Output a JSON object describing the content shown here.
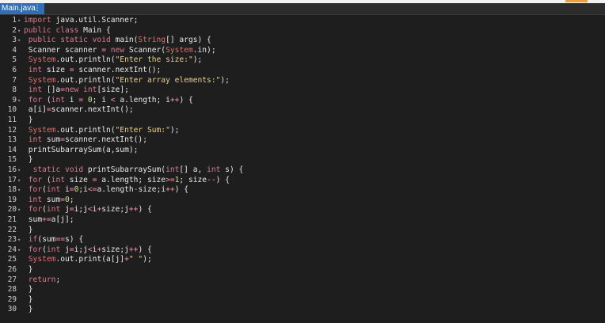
{
  "tab": {
    "label": "Main.java",
    "menu_glyph": "⋮"
  },
  "colors": {
    "tab_active": "#2f6fb8",
    "background": "#1e1e1e",
    "keyword": "#d77a8e",
    "string": "#e8d08a",
    "system": "#e26d6d"
  },
  "editor": {
    "lines": [
      {
        "n": "1",
        "fold": "▾",
        "segs": [
          [
            "kw",
            "import"
          ],
          [
            "pl",
            " java.util.Scanner;"
          ]
        ]
      },
      {
        "n": "2",
        "fold": "▾",
        "segs": [
          [
            "kw",
            "public"
          ],
          [
            "pl",
            " "
          ],
          [
            "kw",
            "class"
          ],
          [
            "pl",
            " Main {"
          ]
        ]
      },
      {
        "n": "3",
        "fold": "▾",
        "segs": [
          [
            "pl",
            " "
          ],
          [
            "kw",
            "public"
          ],
          [
            "pl",
            " "
          ],
          [
            "kw",
            "static"
          ],
          [
            "pl",
            " "
          ],
          [
            "kw",
            "void"
          ],
          [
            "pl",
            " main("
          ],
          [
            "sys",
            "String"
          ],
          [
            "pl",
            "[] args) {"
          ]
        ]
      },
      {
        "n": "4",
        "fold": "",
        "segs": [
          [
            "pl",
            " Scanner scanner "
          ],
          [
            "op",
            "="
          ],
          [
            "pl",
            " "
          ],
          [
            "kw",
            "new"
          ],
          [
            "pl",
            " Scanner("
          ],
          [
            "sys",
            "System"
          ],
          [
            "pl",
            ".in);"
          ]
        ]
      },
      {
        "n": "5",
        "fold": "",
        "segs": [
          [
            "pl",
            " "
          ],
          [
            "sys",
            "System"
          ],
          [
            "pl",
            ".out.println("
          ],
          [
            "str",
            "\"Enter the size:\""
          ],
          [
            "pl",
            ");"
          ]
        ]
      },
      {
        "n": "6",
        "fold": "",
        "segs": [
          [
            "pl",
            " "
          ],
          [
            "kw",
            "int"
          ],
          [
            "pl",
            " size "
          ],
          [
            "op",
            "="
          ],
          [
            "pl",
            " scanner.nextInt();"
          ]
        ]
      },
      {
        "n": "7",
        "fold": "",
        "segs": [
          [
            "pl",
            " "
          ],
          [
            "sys",
            "System"
          ],
          [
            "pl",
            ".out.println("
          ],
          [
            "str",
            "\"Enter array elements:\""
          ],
          [
            "pl",
            ");"
          ]
        ]
      },
      {
        "n": "8",
        "fold": "",
        "segs": [
          [
            "pl",
            " "
          ],
          [
            "kw",
            "int"
          ],
          [
            "pl",
            " []a"
          ],
          [
            "op",
            "="
          ],
          [
            "kw",
            "new"
          ],
          [
            "pl",
            " "
          ],
          [
            "kw",
            "int"
          ],
          [
            "pl",
            "[size];"
          ]
        ]
      },
      {
        "n": "9",
        "fold": "▾",
        "segs": [
          [
            "pl",
            " "
          ],
          [
            "kw",
            "for"
          ],
          [
            "pl",
            " ("
          ],
          [
            "kw",
            "int"
          ],
          [
            "pl",
            " i "
          ],
          [
            "op",
            "="
          ],
          [
            "pl",
            " "
          ],
          [
            "num",
            "0"
          ],
          [
            "pl",
            "; i "
          ],
          [
            "op",
            "<"
          ],
          [
            "pl",
            " a.length; i"
          ],
          [
            "op",
            "++"
          ],
          [
            "pl",
            ") {"
          ]
        ]
      },
      {
        "n": "10",
        "fold": "",
        "segs": [
          [
            "pl",
            " a[i]"
          ],
          [
            "op",
            "="
          ],
          [
            "pl",
            "scanner.nextInt();"
          ]
        ]
      },
      {
        "n": "11",
        "fold": "",
        "segs": [
          [
            "pl",
            " }"
          ]
        ]
      },
      {
        "n": "12",
        "fold": "",
        "segs": [
          [
            "pl",
            " "
          ],
          [
            "sys",
            "System"
          ],
          [
            "pl",
            ".out.println("
          ],
          [
            "str",
            "\"Enter Sum:\""
          ],
          [
            "pl",
            ");"
          ]
        ]
      },
      {
        "n": "13",
        "fold": "",
        "segs": [
          [
            "pl",
            " "
          ],
          [
            "kw",
            "int"
          ],
          [
            "pl",
            " sum"
          ],
          [
            "op",
            "="
          ],
          [
            "pl",
            "scanner.nextInt();"
          ]
        ]
      },
      {
        "n": "14",
        "fold": "",
        "segs": [
          [
            "pl",
            " printSubarraySum(a,sum);"
          ]
        ]
      },
      {
        "n": "15",
        "fold": "",
        "segs": [
          [
            "pl",
            " }"
          ]
        ]
      },
      {
        "n": "16",
        "fold": "▾",
        "segs": [
          [
            "pl",
            "  "
          ],
          [
            "kw",
            "static"
          ],
          [
            "pl",
            " "
          ],
          [
            "kw",
            "void"
          ],
          [
            "pl",
            " printSubarraySum("
          ],
          [
            "kw",
            "int"
          ],
          [
            "pl",
            "[] a, "
          ],
          [
            "kw",
            "int"
          ],
          [
            "pl",
            " s) {"
          ]
        ]
      },
      {
        "n": "17",
        "fold": "▾",
        "segs": [
          [
            "pl",
            " "
          ],
          [
            "kw",
            "for"
          ],
          [
            "pl",
            " ("
          ],
          [
            "kw",
            "int"
          ],
          [
            "pl",
            " size "
          ],
          [
            "op",
            "="
          ],
          [
            "pl",
            " a.length; size"
          ],
          [
            "op",
            ">="
          ],
          [
            "num",
            "1"
          ],
          [
            "pl",
            "; size"
          ],
          [
            "op",
            "--"
          ],
          [
            "pl",
            ") {"
          ]
        ]
      },
      {
        "n": "18",
        "fold": "▾",
        "segs": [
          [
            "pl",
            " "
          ],
          [
            "kw",
            "for"
          ],
          [
            "pl",
            "("
          ],
          [
            "kw",
            "int"
          ],
          [
            "pl",
            " i"
          ],
          [
            "op",
            "="
          ],
          [
            "num",
            "0"
          ],
          [
            "pl",
            ";i"
          ],
          [
            "op",
            "<="
          ],
          [
            "pl",
            "a.length"
          ],
          [
            "op",
            "-"
          ],
          [
            "pl",
            "size;i"
          ],
          [
            "op",
            "++"
          ],
          [
            "pl",
            ") {"
          ]
        ]
      },
      {
        "n": "19",
        "fold": "",
        "segs": [
          [
            "pl",
            " "
          ],
          [
            "kw",
            "int"
          ],
          [
            "pl",
            " sum"
          ],
          [
            "op",
            "="
          ],
          [
            "num",
            "0"
          ],
          [
            "pl",
            ";"
          ]
        ]
      },
      {
        "n": "20",
        "fold": "▾",
        "segs": [
          [
            "pl",
            " "
          ],
          [
            "kw",
            "for"
          ],
          [
            "pl",
            "("
          ],
          [
            "kw",
            "int"
          ],
          [
            "pl",
            " j"
          ],
          [
            "op",
            "="
          ],
          [
            "pl",
            "i;j"
          ],
          [
            "op",
            "<"
          ],
          [
            "pl",
            "i"
          ],
          [
            "op",
            "+"
          ],
          [
            "pl",
            "size;j"
          ],
          [
            "op",
            "++"
          ],
          [
            "pl",
            ") {"
          ]
        ]
      },
      {
        "n": "21",
        "fold": "",
        "segs": [
          [
            "pl",
            " sum"
          ],
          [
            "op",
            "+="
          ],
          [
            "pl",
            "a[j];"
          ]
        ]
      },
      {
        "n": "22",
        "fold": "",
        "segs": [
          [
            "pl",
            " }"
          ]
        ]
      },
      {
        "n": "23",
        "fold": "▾",
        "segs": [
          [
            "pl",
            " "
          ],
          [
            "kw",
            "if"
          ],
          [
            "pl",
            "(sum"
          ],
          [
            "op",
            "=="
          ],
          [
            "pl",
            "s) {"
          ]
        ]
      },
      {
        "n": "24",
        "fold": "▾",
        "segs": [
          [
            "pl",
            " "
          ],
          [
            "kw",
            "for"
          ],
          [
            "pl",
            "("
          ],
          [
            "kw",
            "int"
          ],
          [
            "pl",
            " j"
          ],
          [
            "op",
            "="
          ],
          [
            "pl",
            "i;j"
          ],
          [
            "op",
            "<"
          ],
          [
            "pl",
            "i"
          ],
          [
            "op",
            "+"
          ],
          [
            "pl",
            "size;j"
          ],
          [
            "op",
            "++"
          ],
          [
            "pl",
            ") {"
          ]
        ]
      },
      {
        "n": "25",
        "fold": "",
        "segs": [
          [
            "pl",
            " "
          ],
          [
            "sys",
            "System"
          ],
          [
            "pl",
            ".out.print(a[j]"
          ],
          [
            "op",
            "+"
          ],
          [
            "str",
            "\" \""
          ],
          [
            "pl",
            ");"
          ]
        ]
      },
      {
        "n": "26",
        "fold": "",
        "segs": [
          [
            "pl",
            " }"
          ]
        ]
      },
      {
        "n": "27",
        "fold": "",
        "segs": [
          [
            "pl",
            " "
          ],
          [
            "kw",
            "return"
          ],
          [
            "pl",
            ";"
          ]
        ]
      },
      {
        "n": "28",
        "fold": "",
        "segs": [
          [
            "pl",
            " }"
          ]
        ]
      },
      {
        "n": "29",
        "fold": "",
        "segs": [
          [
            "pl",
            " }"
          ]
        ]
      },
      {
        "n": "30",
        "fold": "",
        "segs": [
          [
            "pl",
            " }"
          ]
        ]
      }
    ]
  }
}
